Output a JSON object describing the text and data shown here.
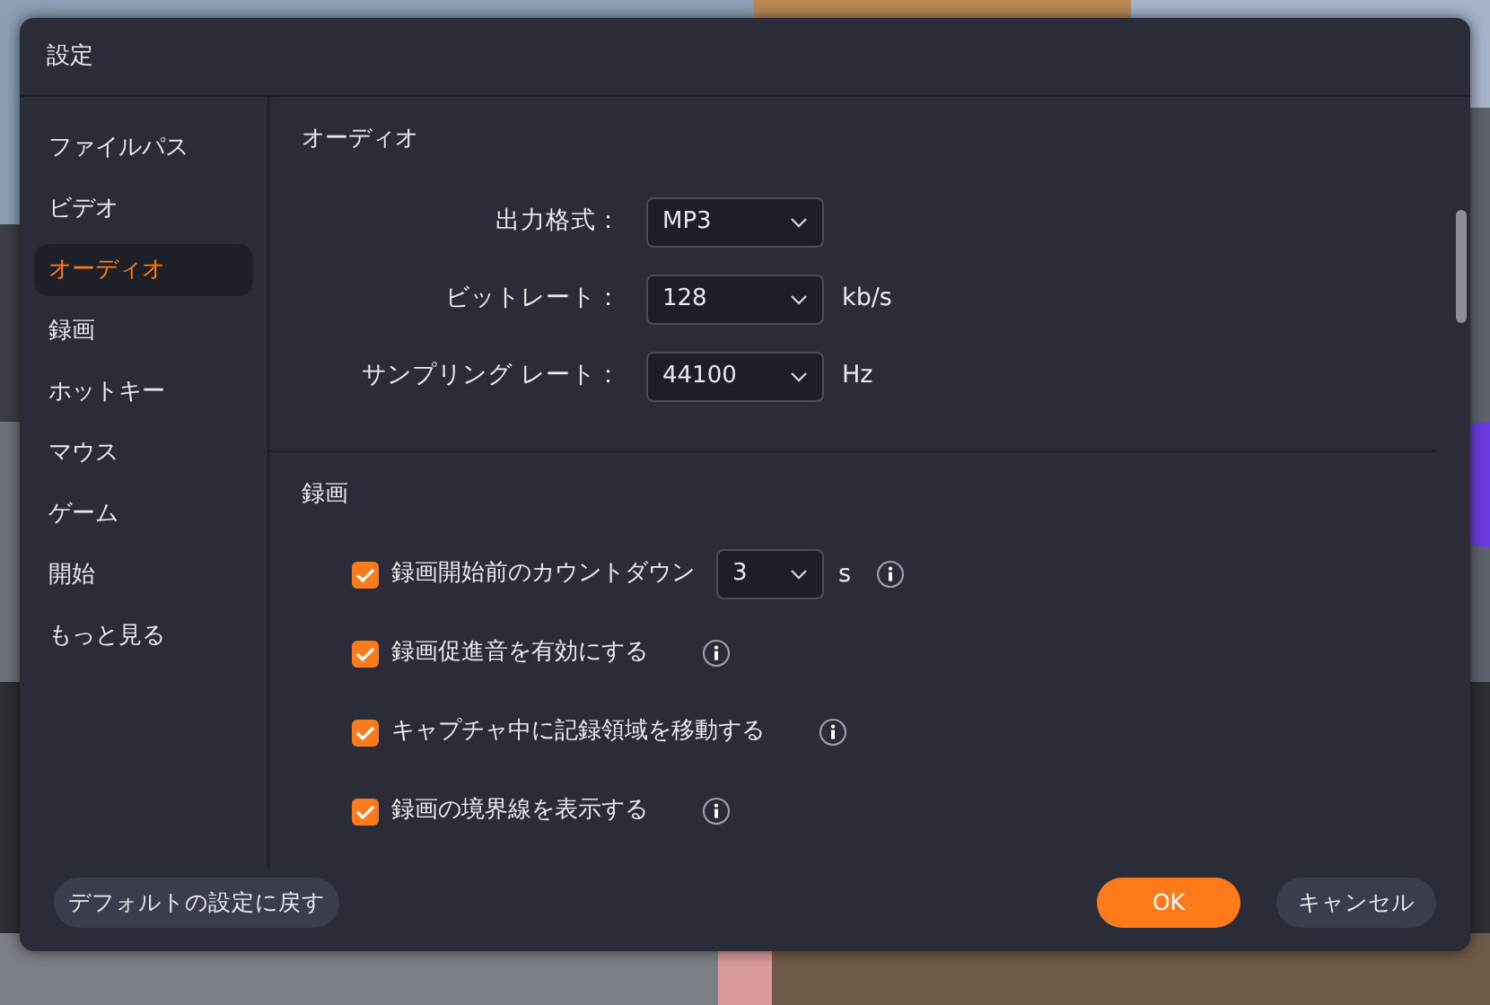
{
  "window": {
    "title": "設定"
  },
  "sidebar": {
    "items": [
      {
        "label": "ファイルパス",
        "selected": false
      },
      {
        "label": "ビデオ",
        "selected": false
      },
      {
        "label": "オーディオ",
        "selected": true
      },
      {
        "label": "録画",
        "selected": false
      },
      {
        "label": "ホットキー",
        "selected": false
      },
      {
        "label": "マウス",
        "selected": false
      },
      {
        "label": "ゲーム",
        "selected": false
      },
      {
        "label": "開始",
        "selected": false
      },
      {
        "label": "もっと見る",
        "selected": false
      }
    ]
  },
  "audio": {
    "title": "オーディオ",
    "fields": [
      {
        "label": "出力格式：",
        "value": "MP3"
      },
      {
        "label": "ビットレート：",
        "value": "128",
        "unit": "kb/s"
      },
      {
        "label": "サンプリング レート：",
        "value": "44100",
        "unit": "Hz"
      }
    ]
  },
  "recording": {
    "title": "録画",
    "options": [
      {
        "label": "録画開始前のカウントダウン",
        "checked": true,
        "value": "3",
        "unit": "s"
      },
      {
        "label": "録画促進音を有効にする",
        "checked": true
      },
      {
        "label": "キャプチャ中に記録領域を移動する",
        "checked": true
      },
      {
        "label": "録画の境界線を表示する",
        "checked": true
      }
    ]
  },
  "footer": {
    "reset": "デフォルトの設定に戻す",
    "ok": "OK",
    "cancel": "キャンセル"
  }
}
